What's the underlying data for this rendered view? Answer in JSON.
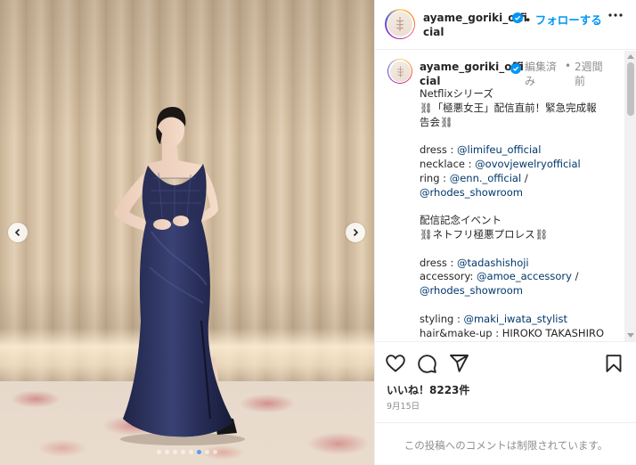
{
  "post": {
    "username": "ayame_goriki_official",
    "username_split": [
      "ayame_goriki_offi",
      "cial"
    ],
    "follow_label": "フォローする",
    "follow_separator": "•",
    "edited_label": "編集済み",
    "edited_split": [
      "編集済",
      "み"
    ],
    "time_ago": "2週間前",
    "time_split": [
      "2週間",
      "前"
    ],
    "likes": "いいね！8223件",
    "date": "9月15日",
    "comments_restricted": "この投稿へのコメントは制限されています。"
  },
  "caption_lines": [
    {
      "type": "text",
      "parts": [
        {
          "t": "Netflixシリーズ"
        }
      ]
    },
    {
      "type": "text",
      "parts": [
        {
          "t": "⛓「極悪女王」配信直前！緊急完成報"
        }
      ]
    },
    {
      "type": "text",
      "parts": [
        {
          "t": "告会⛓"
        }
      ]
    },
    {
      "type": "gap"
    },
    {
      "type": "text",
      "parts": [
        {
          "t": "dress : "
        },
        {
          "t": "@limifeu_official",
          "m": true
        }
      ]
    },
    {
      "type": "text",
      "parts": [
        {
          "t": "necklace : "
        },
        {
          "t": "@ovovjewelryofficial",
          "m": true
        }
      ]
    },
    {
      "type": "text",
      "parts": [
        {
          "t": "ring : "
        },
        {
          "t": "@enn._official",
          "m": true
        },
        {
          "t": " /"
        }
      ]
    },
    {
      "type": "text",
      "parts": [
        {
          "t": "@rhodes_showroom",
          "m": true
        }
      ]
    },
    {
      "type": "gap"
    },
    {
      "type": "text",
      "parts": [
        {
          "t": "配信記念イベント"
        }
      ]
    },
    {
      "type": "text",
      "parts": [
        {
          "t": "⛓ネトフリ極悪プロレス⛓"
        }
      ]
    },
    {
      "type": "gap"
    },
    {
      "type": "text",
      "parts": [
        {
          "t": "dress : "
        },
        {
          "t": "@tadashishoji",
          "m": true
        }
      ]
    },
    {
      "type": "text",
      "parts": [
        {
          "t": "accessory: "
        },
        {
          "t": "@amoe_accessory",
          "m": true
        },
        {
          "t": " /"
        }
      ]
    },
    {
      "type": "text",
      "parts": [
        {
          "t": "@rhodes_showroom",
          "m": true
        }
      ]
    },
    {
      "type": "gap"
    },
    {
      "type": "text",
      "parts": [
        {
          "t": "styling : "
        },
        {
          "t": "@maki_iwata_stylist",
          "m": true
        }
      ]
    },
    {
      "type": "text",
      "parts": [
        {
          "t": "hair&make-up : HIROKO TAKASHIRO"
        }
      ]
    }
  ],
  "carousel": {
    "slide_count": 8,
    "active_index": 5
  },
  "icons": {
    "prev": "chevron-left-icon",
    "next": "chevron-right-icon",
    "verified": "verified-badge-icon",
    "more": "more-options-icon",
    "like": "heart-icon",
    "comment": "comment-icon",
    "share": "share-icon",
    "save": "bookmark-icon"
  },
  "colors": {
    "accent": "#0095f6",
    "mention": "#00376b",
    "muted": "#8e8e8e",
    "text": "#262626"
  }
}
